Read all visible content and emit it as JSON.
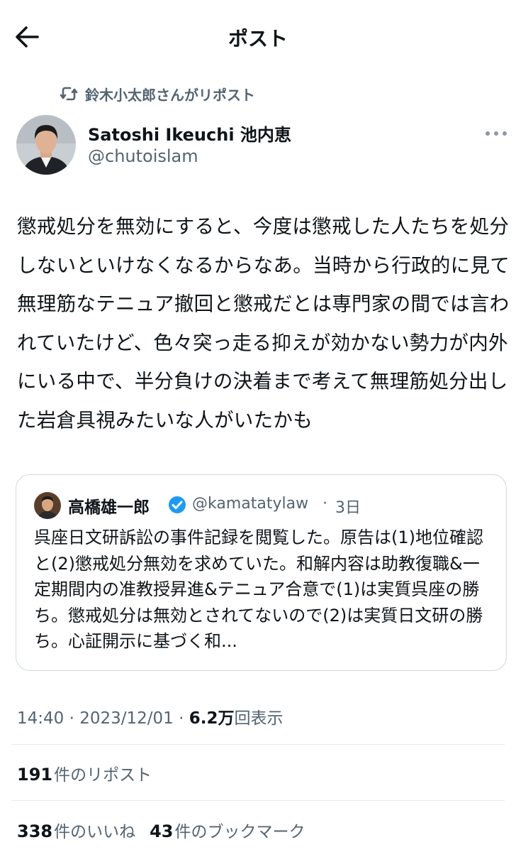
{
  "header": {
    "title": "ポスト",
    "back_icon": "arrow-left-icon"
  },
  "repost": {
    "icon": "repost-icon",
    "text": "鈴木小太郎さんがリポスト"
  },
  "post": {
    "author_name": "Satoshi Ikeuchi 池内恵",
    "author_handle": "@chutoislam",
    "more_icon": "more-horizontal-icon",
    "text": "懲戒処分を無効にすると、今度は懲戒した人たちを処分しないといけなくなるからなあ。当時から行政的に見て無理筋なテニュア撤回と懲戒だとは専門家の間では言われていたけど、色々突っ走る抑えが効かない勢力が内外にいる中で、半分負けの決着まで考えて無理筋処分出した岩倉具視みたいな人がいたかも"
  },
  "quote": {
    "author_name": "高橋雄一郎",
    "verified_icon": "verified-badge-icon",
    "author_handle": "@kamatatylaw",
    "separator": "·",
    "date": "3日",
    "text": "呉座日文研訴訟の事件記録を閲覧した。原告は(1)地位確認と(2)懲戒処分無効を求めていた。和解内容は助教復職&一定期間内の准教授昇進&テニュア合意で(1)は実質呉座の勝ち。懲戒処分は無効とされてないので(2)は実質日文研の勝ち。心証開示に基づく和..."
  },
  "meta": {
    "time": "14:40",
    "date": "2023/12/01",
    "separator": " · ",
    "views_count": "6.2万",
    "views_label": "回表示"
  },
  "stats": {
    "reposts_count": "191",
    "reposts_label": "件のリポスト",
    "likes_count": "338",
    "likes_label": "件のいいね",
    "bookmarks_count": "43",
    "bookmarks_label": "件のブックマーク"
  },
  "colors": {
    "text": "#0f1419",
    "secondary": "#536471",
    "verified": "#1d9bf0",
    "border": "#cfd9de",
    "divider": "#e3e8ea"
  }
}
